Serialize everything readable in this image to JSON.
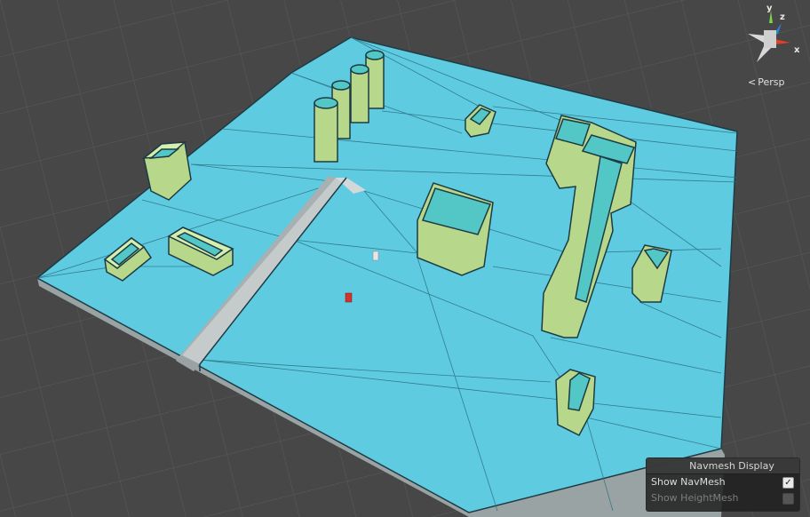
{
  "scene": {
    "background": "#474747",
    "navmesh_color": "#5fcbe0",
    "obstacle_color": "#cfe6a2"
  },
  "gizmo": {
    "axis_y": "y",
    "axis_z": "z",
    "axis_x": "x",
    "y_color": "#7dd34a",
    "z_color": "#2a86d8",
    "x_color": "#e0402a",
    "icon": "orientation-gizmo-icon"
  },
  "view": {
    "chevron": "<",
    "projection_label": "Persp"
  },
  "navmesh_panel": {
    "title": "Navmesh Display",
    "show_navmesh_label": "Show NavMesh",
    "show_navmesh_checked": true,
    "check_glyph": "✓",
    "show_heightmesh_label": "Show HeightMesh",
    "show_heightmesh_checked": false,
    "show_heightmesh_enabled": false
  }
}
